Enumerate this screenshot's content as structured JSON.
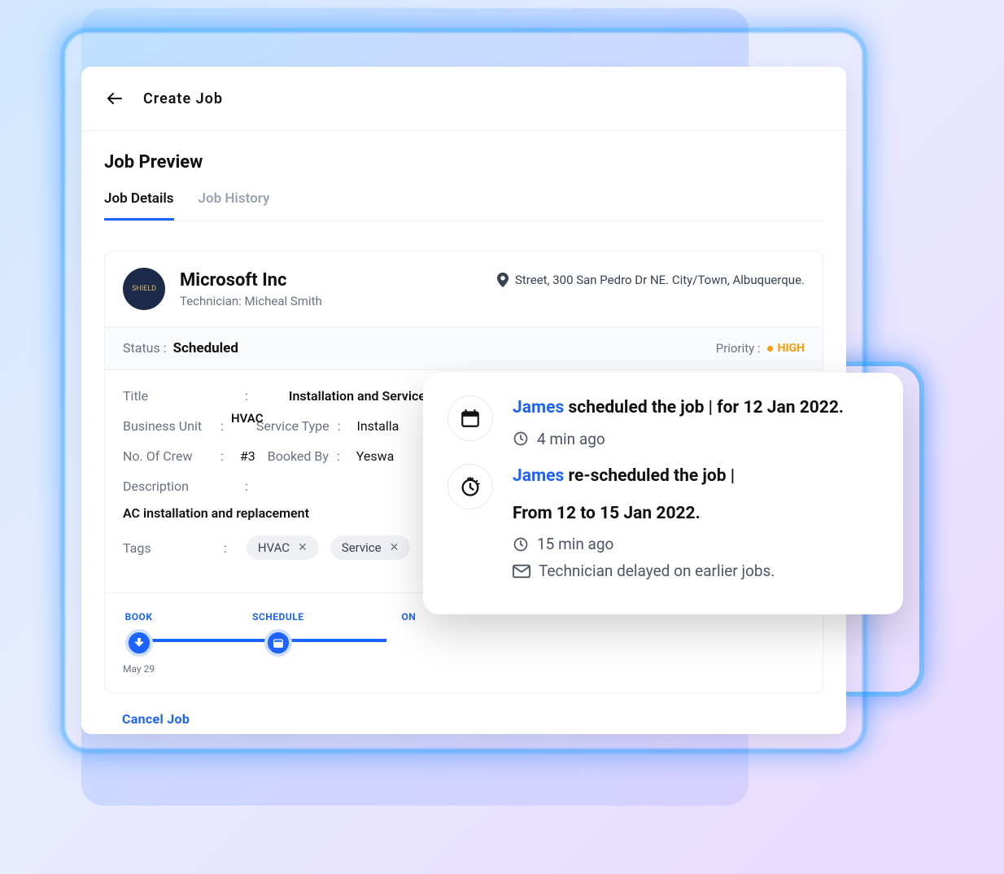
{
  "header": {
    "title": "Create Job"
  },
  "page": {
    "title": "Job Preview"
  },
  "tabs": {
    "details": "Job Details",
    "history": "Job History"
  },
  "company": {
    "name": "Microsoft Inc",
    "technician_label": "Technician: Micheal Smith",
    "avatar_text": "SHIELD",
    "address": "Street, 300 San Pedro Dr NE. City/Town, Albuquerque."
  },
  "status": {
    "label": "Status :",
    "value": "Scheduled",
    "priority_label": "Priority :",
    "priority_value": "HIGH"
  },
  "details": {
    "title_label": "Title",
    "title_value": "Installation and Service",
    "business_unit_label": "Business Unit",
    "business_unit_value": "HVAC",
    "service_type_label": "Service Type",
    "service_type_value": "Installa",
    "crew_label": "No. Of Crew",
    "crew_value": "#3",
    "booked_by_label": "Booked By",
    "booked_by_value": "Yeswa",
    "description_label": "Description",
    "description_value": "AC installation and replacement",
    "tags_label": "Tags",
    "tags": [
      "HVAC",
      "Service"
    ]
  },
  "timeline": {
    "steps": [
      {
        "label": "BOOK",
        "date": "May 29"
      },
      {
        "label": "SCHEDULE",
        "date": ""
      },
      {
        "label": "ON",
        "date": ""
      }
    ]
  },
  "actions": {
    "cancel": "Cancel Job"
  },
  "history": {
    "items": [
      {
        "actor": "James",
        "text_after": " scheduled the job  |  for 12 Jan 2022.",
        "time": "4 min ago",
        "note": ""
      },
      {
        "actor": "James",
        "text_after": " re-scheduled the job  |",
        "line2": "From 12  to 15 Jan 2022.",
        "time": "15 min ago",
        "note": "Technician delayed on earlier jobs."
      }
    ]
  }
}
